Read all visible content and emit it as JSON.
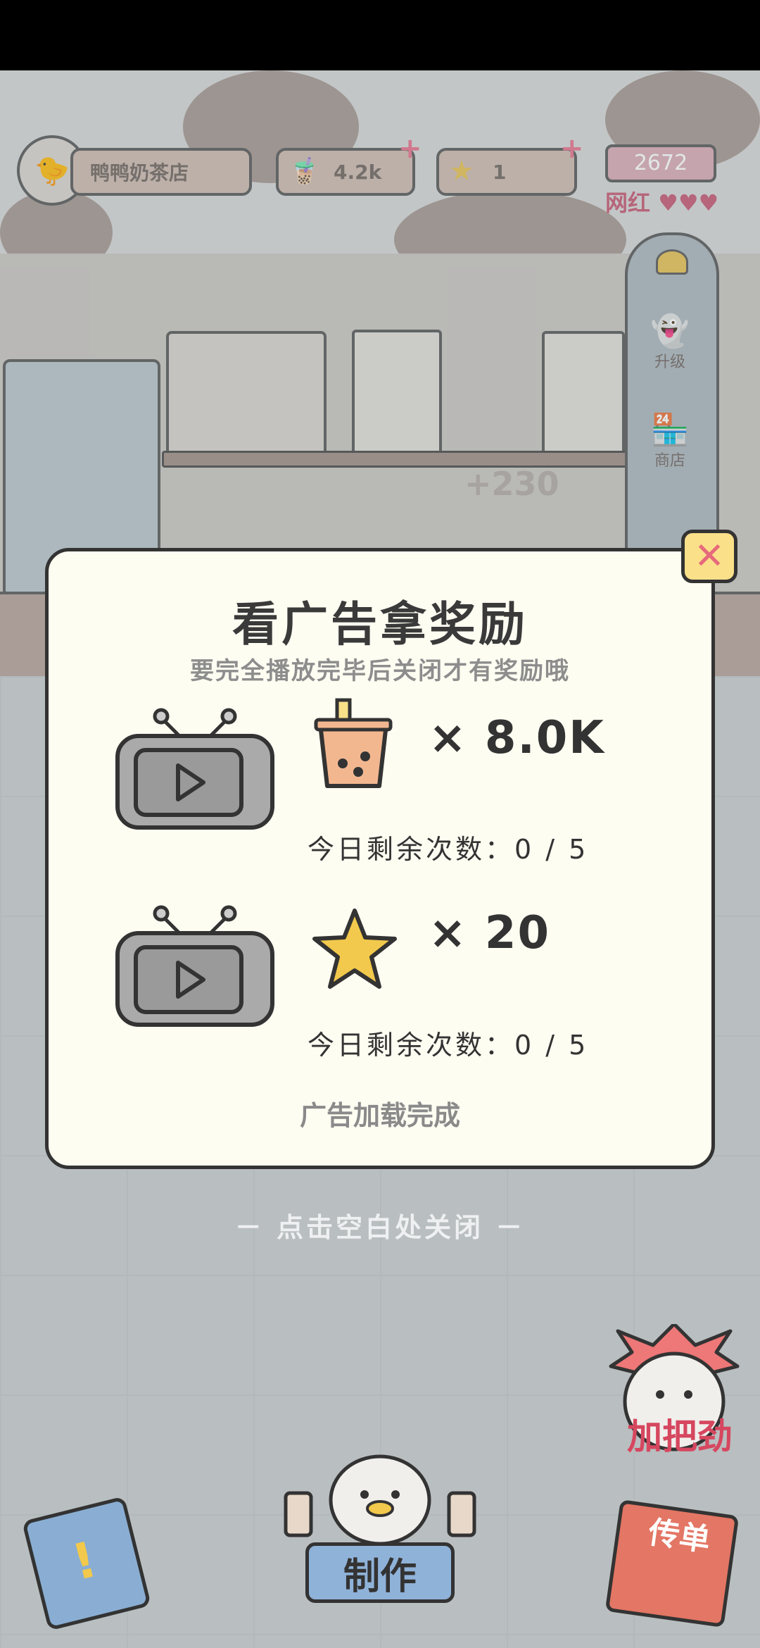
{
  "hud": {
    "shop_name": "鸭鸭奶茶店",
    "tea_count": "4.2k",
    "star_count": "1",
    "popularity_value": "2672",
    "popularity_label": "网红"
  },
  "side_menu": {
    "upgrade_label": "升级",
    "shop_label": "商店"
  },
  "scene": {
    "floating_reward": "+230"
  },
  "popup": {
    "title": "看广告拿奖励",
    "subtitle": "要完全播放完毕后关闭才有奖励哦",
    "rewards": [
      {
        "icon": "milk-tea-icon",
        "quantity": "× 8.0K",
        "remaining": "今日剩余次数：0 / 5"
      },
      {
        "icon": "star-icon",
        "quantity": "× 20",
        "remaining": "今日剩余次数：0 / 5"
      }
    ],
    "ad_status": "广告加载完成"
  },
  "dismiss_hint": "－ 点击空白处关闭 －",
  "bottom": {
    "make_label": "制作",
    "cheer_label": "加把劲",
    "flyer_label": "传单"
  },
  "colors": {
    "popup_bg": "#fdfdf2",
    "close_button": "#fbe08a",
    "close_x": "#e66a7b",
    "make_button": "#8fb2d8"
  }
}
